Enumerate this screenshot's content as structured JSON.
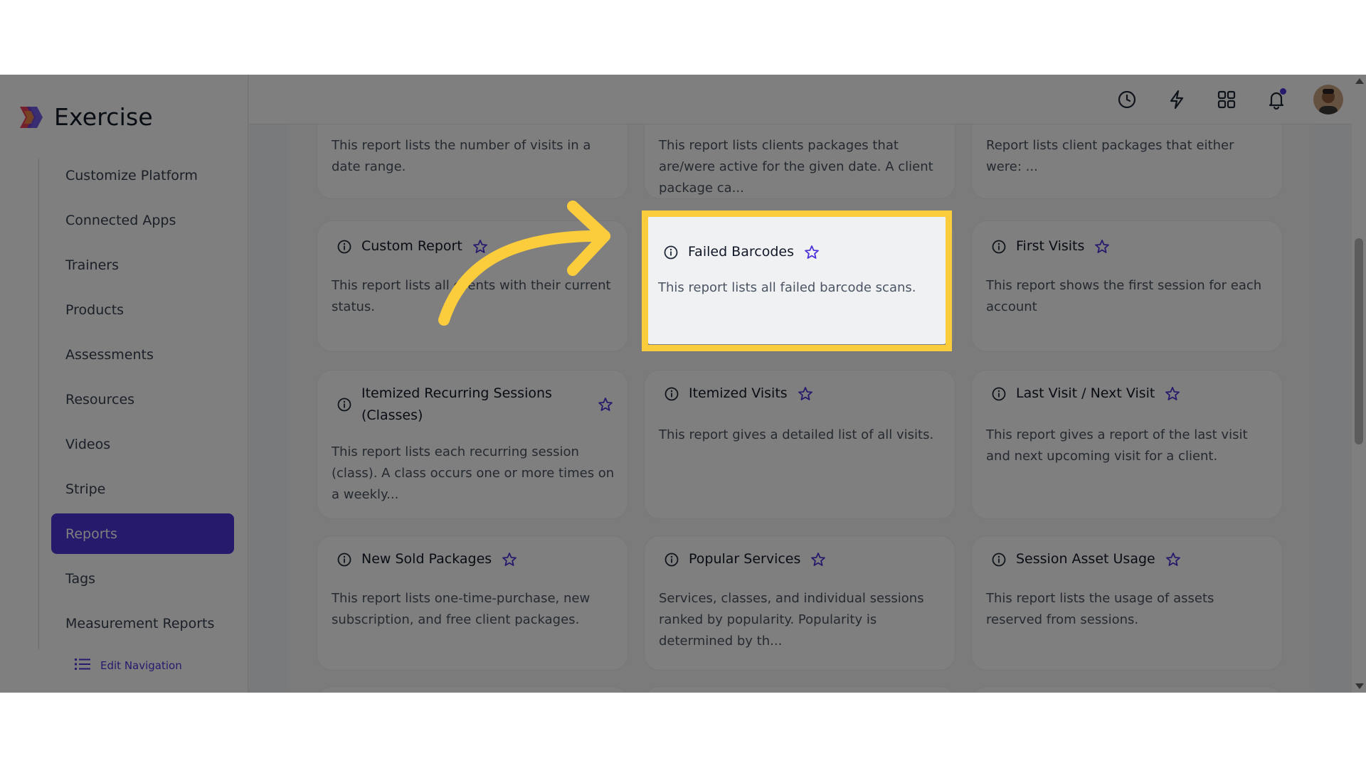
{
  "app": {
    "name": "Exercise"
  },
  "sidebar": {
    "items": [
      {
        "label": "Customize Platform"
      },
      {
        "label": "Connected Apps"
      },
      {
        "label": "Trainers"
      },
      {
        "label": "Products"
      },
      {
        "label": "Assessments"
      },
      {
        "label": "Resources"
      },
      {
        "label": "Videos"
      },
      {
        "label": "Stripe"
      },
      {
        "label": "Reports",
        "active": true
      },
      {
        "label": "Tags"
      },
      {
        "label": "Measurement Reports"
      }
    ],
    "edit_navigation_label": "Edit Navigation"
  },
  "topbar": {
    "icons": [
      "clock-icon",
      "lightning-icon",
      "apps-grid-icon",
      "bell-icon",
      "avatar"
    ],
    "has_notification": true
  },
  "reports": {
    "row0": [
      {
        "description": "This report lists the number of visits in a date range."
      },
      {
        "description": "This report lists clients packages that are/were active for the given date. A client package ca..."
      },
      {
        "description": "Report lists client packages that either were: ..."
      }
    ],
    "custom_report": {
      "title": "Custom Report",
      "description": "This report lists all clients with their current status."
    },
    "failed_barcodes": {
      "title": "Failed Barcodes",
      "description": "This report lists all failed barcode scans."
    },
    "first_visits": {
      "title": "First Visits",
      "description": "This report shows the first session for each account"
    },
    "itemized_recurring": {
      "title": "Itemized Recurring Sessions (Classes)",
      "description": "This report lists each recurring session (class). A class occurs one or more times on a weekly..."
    },
    "itemized_visits": {
      "title": "Itemized Visits",
      "description": "This report gives a detailed list of all visits."
    },
    "last_next_visit": {
      "title": "Last Visit / Next Visit",
      "description": "This report gives a report of the last visit and next upcoming visit for a client."
    },
    "new_sold_packages": {
      "title": "New Sold Packages",
      "description": "This report lists one-time-purchase, new subscription, and free client packages."
    },
    "popular_services": {
      "title": "Popular Services",
      "description": "Services, classes, and individual sessions ranked by popularity. Popularity is determined by th..."
    },
    "session_asset_usage": {
      "title": "Session Asset Usage",
      "description": "This report lists the usage of assets reserved from sessions."
    }
  },
  "colors": {
    "accent": "#4c34d8",
    "highlight": "#fbcd3d",
    "overlay": "rgba(0,0,0,0.5)"
  }
}
